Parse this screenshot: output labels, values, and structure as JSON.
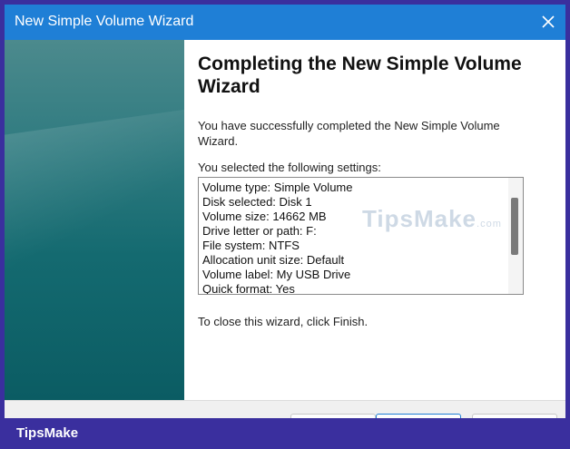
{
  "window": {
    "title": "New Simple Volume Wizard"
  },
  "main": {
    "heading": "Completing the New Simple Volume Wizard",
    "description": "You have successfully completed the New Simple Volume Wizard.",
    "settings_label": "You selected the following settings:",
    "settings": [
      "Volume type: Simple Volume",
      "Disk selected: Disk 1",
      "Volume size: 14662 MB",
      "Drive letter or path: F:",
      "File system: NTFS",
      "Allocation unit size: Default",
      "Volume label: My USB Drive",
      "Quick format: Yes"
    ],
    "close_hint": "To close this wizard, click Finish."
  },
  "watermark": {
    "text": "TipsMake",
    "suffix": ".com"
  },
  "brand": {
    "name": "TipsMake"
  },
  "colors": {
    "titlebar": "#1f7fd6",
    "frame": "#3a2f9e",
    "sidebar": "#146a70"
  }
}
